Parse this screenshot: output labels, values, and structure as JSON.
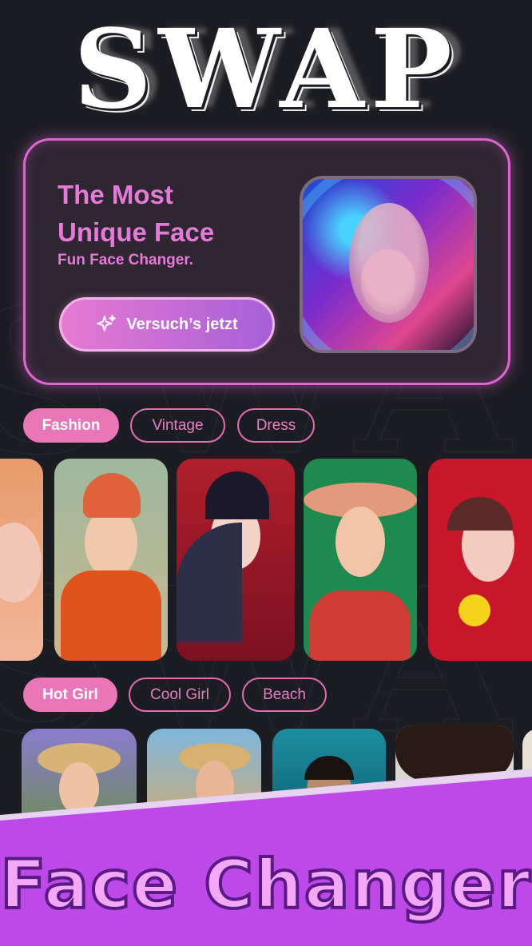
{
  "logo": "SWAP",
  "hero": {
    "title": "The Most Unique Face",
    "subtitle": "Fun Face Changer.",
    "cta_label": "Versuch’s jetzt"
  },
  "sections": [
    {
      "chips": [
        {
          "label": "Fashion",
          "active": true
        },
        {
          "label": "Vintage",
          "active": false
        },
        {
          "label": "Dress",
          "active": false
        }
      ]
    },
    {
      "chips": [
        {
          "label": "Hot Girl",
          "active": true
        },
        {
          "label": "Cool Girl",
          "active": false
        },
        {
          "label": "Beach",
          "active": false
        }
      ]
    }
  ],
  "banner": "Face Changer",
  "colors": {
    "accent": "#e976b8",
    "banner": "#bd4ae8",
    "background": "#1c1d22"
  }
}
